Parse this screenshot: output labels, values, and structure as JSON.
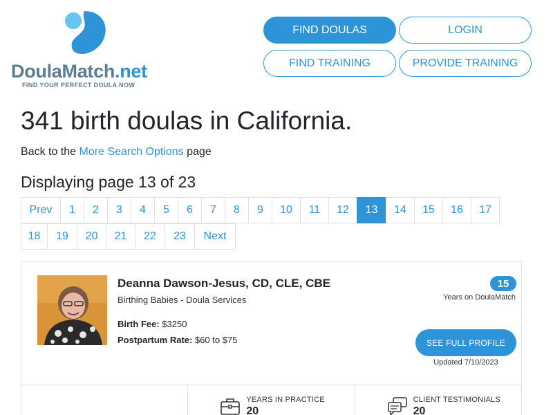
{
  "header": {
    "logo": {
      "name_part1": "Doula",
      "name_part2": "Match",
      "name_part3": ".net",
      "tagline": "FIND YOUR PERFECT DOULA NOW"
    },
    "nav": {
      "find_doulas": "FIND DOULAS",
      "login": "LOGIN",
      "find_training": "FIND TRAINING",
      "provide_training": "PROVIDE TRAINING"
    }
  },
  "main": {
    "title": "341 birth doulas in California.",
    "back": {
      "prefix": "Back to the ",
      "link": "More Search Options",
      "suffix": " page"
    },
    "displaying": "Displaying page 13 of 23",
    "pagination": {
      "row1": [
        "Prev",
        "1",
        "2",
        "3",
        "4",
        "5",
        "6",
        "7",
        "8",
        "9",
        "10",
        "11",
        "12",
        "13",
        "14",
        "15",
        "16",
        "17"
      ],
      "row2": [
        "18",
        "19",
        "20",
        "21",
        "22",
        "23",
        "Next"
      ],
      "active": "13"
    }
  },
  "card": {
    "name": "Deanna Dawson-Jesus, CD, CLE, CBE",
    "business": "Birthing Babies - Doula Services",
    "birth_fee_label": "Birth Fee:",
    "birth_fee_value": " $3250",
    "postpartum_label": "Postpartum Rate:",
    "postpartum_value": " $60 to $75",
    "years_on_site": "15",
    "years_on_site_label": "Years on DoulaMatch",
    "profile_button": "SEE FULL PROFILE",
    "updated": "Updated 7/10/2023",
    "stats": [
      {
        "label": "YEARS IN PRACTICE",
        "value": "20",
        "icon": "briefcase-icon"
      },
      {
        "label": "CLIENT TESTIMONIALS",
        "value": "20",
        "icon": "chat-bubbles-icon"
      }
    ]
  },
  "colors": {
    "accent": "#2d94d7",
    "logo_gray": "#5b7d92",
    "border": "#dee2e6"
  }
}
